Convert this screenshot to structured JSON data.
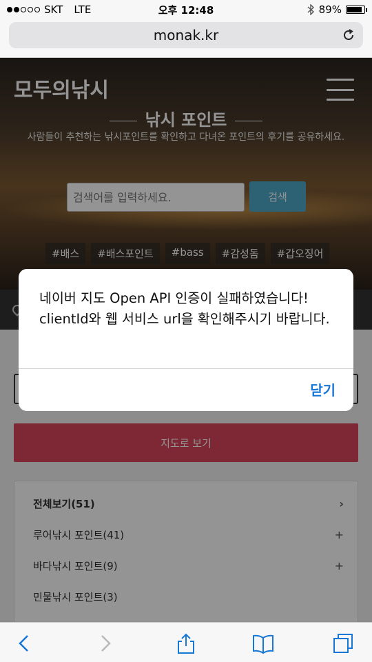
{
  "status_bar": {
    "carrier": "SKT",
    "network": "LTE",
    "time": "오후 12:48",
    "battery": "89%",
    "battery_level": 0.89,
    "bluetooth_icon": "bluetooth-icon"
  },
  "browser": {
    "url": "monak.kr",
    "reload_icon": "reload-icon"
  },
  "site": {
    "logo": "모두의낚시",
    "menu_icon": "hamburger-menu-icon",
    "section_title": "낚시 포인트",
    "subtitle": "사람들이 추천하는 낚시포인트를 확인하고 다녀온 포인트의 후기를 공유하세요.",
    "search_placeholder": "검색어를 입력하세요.",
    "search_button": "검색",
    "tags": [
      "#배스",
      "#배스포인트",
      "#bass",
      "#감성돔",
      "#갑오징어"
    ],
    "map_button": "지도로 보기",
    "categories": [
      {
        "label": "전체보기(51)",
        "icon": "›"
      },
      {
        "label": "루어낚시 포인트(41)",
        "icon": "+"
      },
      {
        "label": "바다낚시 포인트(9)",
        "icon": "+"
      },
      {
        "label": "민물낚시 포인트(3)",
        "icon": ""
      }
    ]
  },
  "alert": {
    "message": "네이버 지도 Open API 인증이 실패하였습니다! clientId와 웹 서비스 url을 확인해주시기 바랍니다.",
    "close_button": "닫기"
  },
  "toolbar": {
    "items": [
      "back-icon",
      "forward-icon",
      "share-icon",
      "bookmarks-icon",
      "tabs-icon"
    ]
  },
  "colors": {
    "accent_blue": "#4ea7c9",
    "map_button": "#d9465c",
    "alert_button": "#1677d6"
  }
}
